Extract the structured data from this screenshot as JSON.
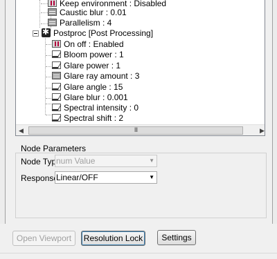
{
  "tree": {
    "items": [
      {
        "label": "Keep environment : Disabled",
        "icon": "toggle-icon"
      },
      {
        "label": "Caustic blur : 0.01",
        "icon": "number-icon"
      },
      {
        "label": "Parallelism : 4",
        "icon": "number-icon"
      },
      {
        "label": "Postproc  [Post Processing]",
        "icon": "group-icon"
      },
      {
        "label": "On off : Enabled",
        "icon": "toggle-icon"
      },
      {
        "label": "Bloom power : 1",
        "icon": "curve-icon"
      },
      {
        "label": "Glare power : 1",
        "icon": "curve-icon"
      },
      {
        "label": "Glare ray amount : 3",
        "icon": "number-icon"
      },
      {
        "label": "Glare angle : 15",
        "icon": "curve-icon"
      },
      {
        "label": "Glare blur : 0.001",
        "icon": "curve-icon"
      },
      {
        "label": "Spectral intensity : 0",
        "icon": "curve-icon"
      },
      {
        "label": "Spectral shift : 2",
        "icon": "curve-icon"
      }
    ],
    "scroll_thumb_grip": "III"
  },
  "params": {
    "title": "Node Parameters",
    "node_type_label": "Node Type:",
    "node_type_value": "num Value",
    "response_label": "Response:",
    "response_value": "Linear/OFF"
  },
  "buttons": {
    "open_viewport": "Open Viewport",
    "resolution_lock": "Resolution Lock",
    "settings": "Settings"
  }
}
